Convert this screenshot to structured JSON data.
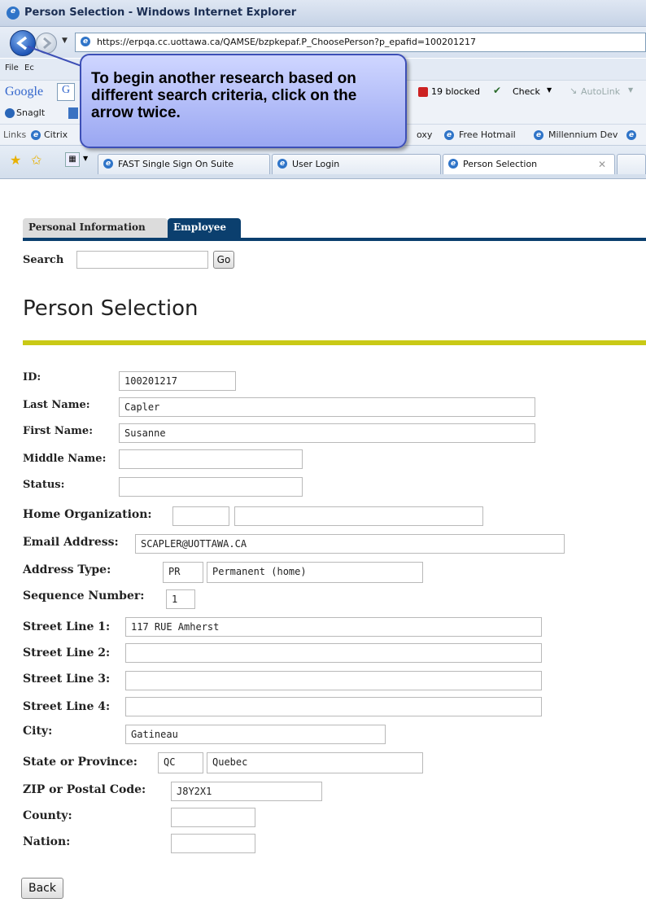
{
  "window": {
    "title": "Person Selection - Windows Internet Explorer"
  },
  "address_bar": {
    "url": "https://erpqa.cc.uottawa.ca/QAMSE/bzpkepaf.P_ChoosePerson?p_epafid=100201217"
  },
  "menu": {
    "file": "File",
    "edit_partial": "Ec"
  },
  "google_toolbar": {
    "google_label": "Google",
    "g_partial": "G",
    "popups_blocked": "19 blocked",
    "check_label": "Check",
    "autolink_label": "AutoLink"
  },
  "snagit_toolbar": {
    "snagit_label": "SnagIt"
  },
  "links_bar": {
    "links_label": "Links",
    "citrix_partial": "Citrix",
    "proxy_partial": "oxy",
    "free_hotmail": "Free Hotmail",
    "millennium_dev": "Millennium Dev"
  },
  "tabs": [
    {
      "label": "FAST Single Sign On Suite"
    },
    {
      "label": "User Login"
    },
    {
      "label": "Person Selection"
    }
  ],
  "callout": {
    "text": "To begin another research based on different search criteria, click on the arrow twice."
  },
  "page_tabs": {
    "personal": "Personal Information",
    "employee": "Employee"
  },
  "search": {
    "label": "Search",
    "value": "",
    "go_label": "Go"
  },
  "page_title": "Person Selection",
  "fields": {
    "id": {
      "label": "ID:",
      "value": "100201217"
    },
    "last_name": {
      "label": "Last Name:",
      "value": "Capler"
    },
    "first_name": {
      "label": "First Name:",
      "value": "Susanne"
    },
    "middle_name": {
      "label": "Middle Name:",
      "value": ""
    },
    "status": {
      "label": "Status:",
      "value": ""
    },
    "home_org": {
      "label": "Home Organization:",
      "code": "",
      "desc": ""
    },
    "email": {
      "label": "Email Address:",
      "value": "SCAPLER@UOTTAWA.CA"
    },
    "address_type": {
      "label": "Address Type:",
      "code": "PR",
      "desc": "Permanent (home)"
    },
    "sequence": {
      "label": "Sequence Number:",
      "value": "1"
    },
    "street1": {
      "label": "Street Line 1:",
      "value": "117 RUE Amherst"
    },
    "street2": {
      "label": "Street Line 2:",
      "value": ""
    },
    "street3": {
      "label": "Street Line 3:",
      "value": ""
    },
    "street4": {
      "label": "Street Line 4:",
      "value": ""
    },
    "city": {
      "label": "City:",
      "value": "Gatineau"
    },
    "state": {
      "label": "State or Province:",
      "code": "QC",
      "desc": "Quebec"
    },
    "zip": {
      "label": "ZIP or Postal Code:",
      "value": "J8Y2X1"
    },
    "county": {
      "label": "County:",
      "value": ""
    },
    "nation": {
      "label": "Nation:",
      "value": ""
    }
  },
  "back_button": "Back",
  "colors": {
    "nav_blue": "#0b3f6e",
    "accent_rule": "#c9c916",
    "callout_fill": "#aab5f4"
  }
}
